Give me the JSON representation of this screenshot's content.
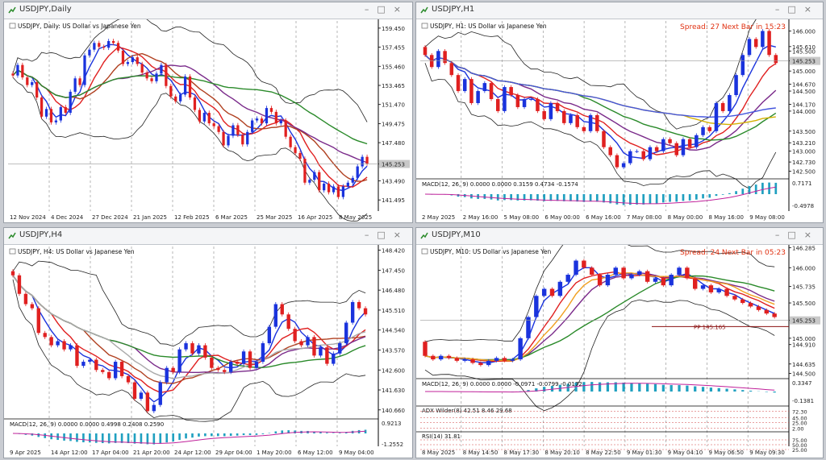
{
  "windows": [
    {
      "id": "daily",
      "title": "USDJPY,Daily",
      "header": "USDJPY, Daily:  US Dollar vs Japanese Yen",
      "prices": [
        "159.450",
        "157.455",
        "155.460",
        "153.465",
        "151.470",
        "149.475",
        "147.480",
        "145.253",
        "143.490",
        "141.495"
      ],
      "price_tag": "145.253",
      "dates": [
        "12 Nov 2024",
        "4 Dec 2024",
        "27 Dec 2024",
        "21 Jan 2025",
        "12 Feb 2025",
        "6 Mar 2025",
        "25 Mar 2025",
        "16 Apr 2025",
        "8 May 2025"
      ],
      "spread": "",
      "macd": "",
      "macd_levels": []
    },
    {
      "id": "h1",
      "title": "USDJPY,H1",
      "header": "USDJPY, H1:  US Dollar vs Japanese Yen",
      "prices": [
        "146.000",
        "145.610",
        "145.500",
        "145.253",
        "145.000",
        "144.670",
        "144.500",
        "144.170",
        "144.000",
        "143.500",
        "143.210",
        "143.000",
        "142.730",
        "142.500"
      ],
      "price_tag": "145.253",
      "dates": [
        "2 May 2025",
        "2 May 16:00",
        "5 May 08:00",
        "6 May 00:00",
        "6 May 16:00",
        "7 May 08:00",
        "8 May 00:00",
        "8 May 16:00",
        "9 May 08:00"
      ],
      "spread": "Spread: 27  Next Bar in 15:23",
      "macd": "MACD(12, 26, 9) 0.0000 0.0000 0.3159 0.4734 -0.1574",
      "macd_levels": [
        "0.7171",
        "-0.4978"
      ]
    },
    {
      "id": "h4",
      "title": "USDJPY,H4",
      "header": "USDJPY, H4:  US Dollar vs Japanese Yen",
      "prices": [
        "148.420",
        "147.450",
        "146.480",
        "145.510",
        "144.540",
        "143.570",
        "142.600",
        "141.630",
        "140.660"
      ],
      "price_tag": "145.253",
      "dates": [
        "9 Apr 2025",
        "14 Apr 12:00",
        "17 Apr 04:00",
        "21 Apr 20:00",
        "24 Apr 12:00",
        "29 Apr 04:00",
        "1 May 20:00",
        "6 May 12:00",
        "9 May 04:00"
      ],
      "spread": "",
      "macd": "MACD(12, 26, 9) 0.0000 0.0000 0.4998 0.2408 0.2590",
      "macd_levels": [
        "0.9213",
        "-1.2552"
      ]
    },
    {
      "id": "m10",
      "title": "USDJPY,M10",
      "header": "USDJPY, M10:  US Dollar vs Japanese Yen",
      "prices": [
        "146.285",
        "146.000",
        "145.735",
        "145.500",
        "145.253",
        "145.000",
        "144.910",
        "144.635",
        "144.500"
      ],
      "price_tag": "145.253",
      "dates": [
        "8 May 2025",
        "8 May 14:50",
        "8 May 17:30",
        "8 May 20:10",
        "8 May 22:50",
        "9 May 01:30",
        "9 May 04:10",
        "9 May 06:50",
        "9 May 09:30"
      ],
      "spread": "Spread: 24  Next Bar in 05:23",
      "pp": "PP 145.165",
      "macd": "MACD(12, 26, 9) 0.0000 0.0000 -0.0971 -0.0799 -0.0172",
      "macd_levels": [
        "0.3347",
        "-0.1381"
      ],
      "adx": "ADX Wilder(8) 42.51 8.46 29.68",
      "adx_levels": [
        "72.30",
        "45.00",
        "25.00",
        "2.00"
      ],
      "rsi": "RSI(14) 31.81",
      "rsi_levels": [
        "75.00",
        "50.00",
        "25.00"
      ]
    }
  ],
  "chart_data": [
    {
      "type": "candlestick",
      "title": "USDJPY, Daily:  US Dollar vs Japanese Yen",
      "x_labels": [
        "12 Nov 2024",
        "4 Dec 2024",
        "27 Dec 2024",
        "21 Jan 2025",
        "12 Feb 2025",
        "6 Mar 2025",
        "25 Mar 2025",
        "16 Apr 2025",
        "8 May 2025"
      ],
      "ylim": [
        140.5,
        160.2
      ],
      "close": [
        154.5,
        155.6,
        154.3,
        153.5,
        153.8,
        152.2,
        150.2,
        151.0,
        149.6,
        149.8,
        151.2,
        150.6,
        152.8,
        154.2,
        153.5,
        156.6,
        157.2,
        157.9,
        157.5,
        157.4,
        158.1,
        157.9,
        157.1,
        155.7,
        155.9,
        156.4,
        155.7,
        154.8,
        154.2,
        153.9,
        154.7,
        155.6,
        153.4,
        152.3,
        151.8,
        152.5,
        154.4,
        152.2,
        150.9,
        149.7,
        150.6,
        149.5,
        149.2,
        148.6,
        147.2,
        148.2,
        149.3,
        148.3,
        147.3,
        148.6,
        149.8,
        150.0,
        149.5,
        151.1,
        150.7,
        149.5,
        149.8,
        148.1,
        147.0,
        146.4,
        145.8,
        143.3,
        143.6,
        144.4,
        142.5,
        143.2,
        142.3,
        142.9,
        141.8,
        142.9,
        143.3,
        143.8,
        145.0,
        146.0,
        145.3
      ]
    },
    {
      "type": "candlestick",
      "title": "USDJPY, H1:  US Dollar vs Japanese Yen",
      "x_labels": [
        "2 May 2025",
        "2 May 16:00",
        "5 May 08:00",
        "6 May 00:00",
        "6 May 16:00",
        "7 May 08:00",
        "8 May 00:00",
        "8 May 16:00",
        "9 May 08:00"
      ],
      "ylim": [
        142.35,
        146.25
      ],
      "close": [
        145.4,
        145.1,
        145.5,
        145.2,
        144.9,
        144.5,
        144.8,
        144.2,
        144.5,
        144.7,
        144.3,
        144.0,
        144.6,
        144.4,
        144.1,
        144.3,
        144.3,
        144.0,
        143.8,
        144.2,
        144.0,
        143.7,
        143.9,
        143.6,
        143.5,
        143.9,
        143.5,
        143.1,
        142.9,
        142.6,
        142.7,
        143.0,
        143.0,
        142.8,
        143.1,
        143.0,
        143.3,
        143.2,
        142.9,
        143.3,
        143.1,
        143.4,
        143.6,
        143.5,
        144.2,
        144.0,
        144.4,
        144.9,
        145.4,
        145.8,
        145.6,
        146.0,
        145.4,
        145.2
      ]
    },
    {
      "type": "candlestick",
      "title": "USDJPY, H4:  US Dollar vs Japanese Yen",
      "x_labels": [
        "9 Apr 2025",
        "14 Apr 12:00",
        "17 Apr 04:00",
        "21 Apr 20:00",
        "24 Apr 12:00",
        "29 Apr 04:00",
        "1 May 20:00",
        "6 May 12:00",
        "9 May 04:00"
      ],
      "ylim": [
        140.3,
        148.6
      ],
      "close": [
        147.2,
        146.3,
        145.8,
        145.6,
        144.4,
        144.2,
        143.8,
        144.0,
        143.6,
        143.8,
        142.8,
        143.0,
        143.1,
        142.6,
        142.5,
        142.2,
        143.0,
        142.3,
        142.0,
        141.2,
        141.5,
        140.6,
        140.9,
        142.0,
        142.7,
        142.5,
        143.6,
        143.9,
        143.4,
        143.8,
        143.2,
        142.7,
        142.6,
        142.5,
        143.0,
        142.9,
        143.5,
        142.7,
        143.0,
        143.9,
        144.7,
        145.8,
        145.3,
        144.6,
        144.0,
        143.8,
        144.2,
        143.3,
        143.7,
        142.9,
        143.4,
        143.9,
        144.9,
        145.9,
        145.6,
        145.3
      ]
    },
    {
      "type": "candlestick",
      "title": "USDJPY, M10:  US Dollar vs Japanese Yen",
      "x_labels": [
        "8 May 2025",
        "8 May 14:50",
        "8 May 17:30",
        "8 May 20:10",
        "8 May 22:50",
        "9 May 01:30",
        "9 May 04:10",
        "9 May 06:50",
        "9 May 09:30"
      ],
      "ylim": [
        144.45,
        146.3
      ],
      "close": [
        144.75,
        144.7,
        144.75,
        144.72,
        144.68,
        144.7,
        144.65,
        144.62,
        144.68,
        144.72,
        144.68,
        144.7,
        145.0,
        145.3,
        145.6,
        145.7,
        145.6,
        145.8,
        145.9,
        146.1,
        146.0,
        145.9,
        145.75,
        145.9,
        146.0,
        145.85,
        145.9,
        145.95,
        145.8,
        145.85,
        145.75,
        145.9,
        146.0,
        145.85,
        145.7,
        145.75,
        145.65,
        145.7,
        145.6,
        145.55,
        145.5,
        145.45,
        145.4,
        145.35,
        145.3
      ]
    }
  ]
}
